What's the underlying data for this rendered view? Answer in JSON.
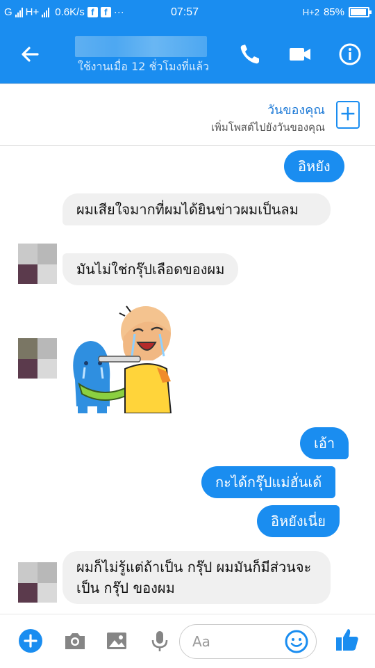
{
  "status_bar": {
    "carrier1": "G",
    "net1": "H+",
    "speed": "0.6K/s",
    "more": "···",
    "time": "07:57",
    "net2": "H+2",
    "battery": "85%"
  },
  "header": {
    "subtitle": "ใช้งานเมื่อ 12 ชั่วโมงที่แล้ว"
  },
  "your_day": {
    "title": "วันของคุณ",
    "subtitle": "เพิ่มโพสต์ไปยังวันของคุณ",
    "plus": "+"
  },
  "messages": [
    {
      "side": "out",
      "text": "อิหยัง"
    },
    {
      "side": "in",
      "text": "ผมเสียใจมากที่ผมได้ยินข่าวผมเป็นลม"
    },
    {
      "side": "in",
      "text": "มันไม่ใช่กรุ๊ปเลือดของผม"
    },
    {
      "side": "out",
      "text": "เอ้า"
    },
    {
      "side": "out",
      "text": "กะได้กรุ๊ปแม่ฮั่นเด้"
    },
    {
      "side": "out",
      "text": "อิหยังเนี่ย"
    },
    {
      "side": "in",
      "text": "ผมก็ไม่รู้แต่ถ้าเป็น กรุ๊ป ผมมันก็มีส่วนจะเป็น กรุ๊ป ของผม"
    }
  ],
  "composer": {
    "placeholder": "Aa"
  },
  "colors": {
    "accent": "#1a8df0",
    "incoming_bubble": "#f0f0f0"
  }
}
